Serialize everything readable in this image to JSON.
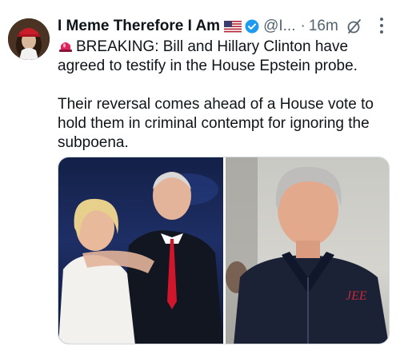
{
  "tweet": {
    "display_name": "I Meme Therefore I Am",
    "handle": "@I...",
    "separator": "·",
    "time": "16m",
    "paragraph1": "BREAKING: Bill and Hillary Clinton have agreed to testify in the House Epstein probe.",
    "paragraph2": "Their reversal comes ahead of a House vote to hold them in criminal contempt for ignoring the subpoena."
  },
  "icons": {
    "avatar": "avatar",
    "flag": "us-flag-icon",
    "verified": "verified-badge-icon",
    "grok": "grok-icon",
    "more": "more-options-icon",
    "siren": "siren-icon"
  },
  "colors": {
    "text": "#0f1419",
    "secondary": "#536471",
    "verified": "#1d9bf0"
  }
}
